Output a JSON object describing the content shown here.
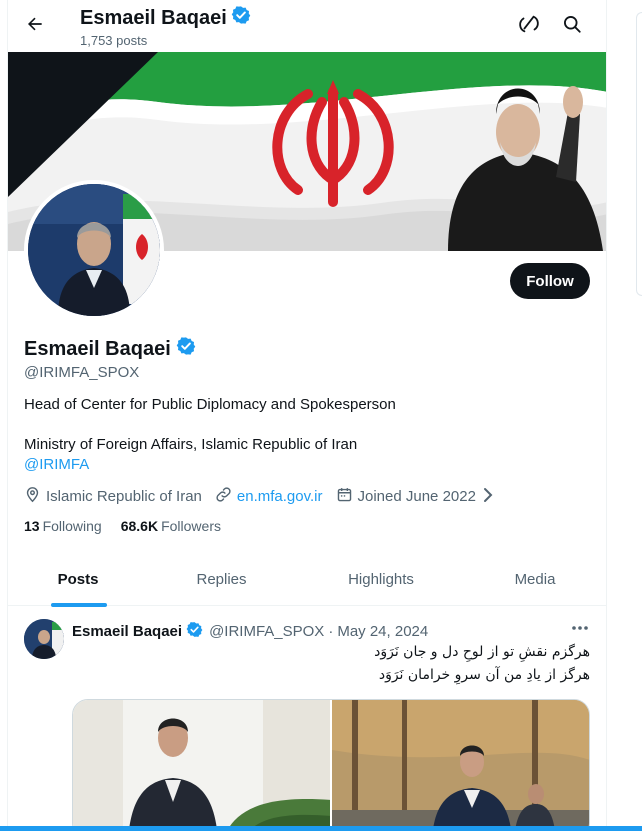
{
  "header": {
    "name": "Esmaeil Baqaei",
    "posts": "1,753 posts"
  },
  "icons": {
    "back": "arrow-left-icon",
    "grok": "grok-icon",
    "search": "search-icon",
    "verified": "verified-badge-icon"
  },
  "colors": {
    "accent": "#1d9bf0",
    "text": "#0f1419",
    "muted": "#536471"
  },
  "profile": {
    "name": "Esmaeil Baqaei",
    "handle": "@IRIMFA_SPOX",
    "bio_line1": "Head of Center for Public Diplomacy and Spokesperson",
    "bio_line2": "Ministry of Foreign Affairs, Islamic Republic of Iran",
    "bio_mention": "@IRIMFA",
    "location": "Islamic Republic of Iran",
    "website": "en.mfa.gov.ir",
    "joined": "Joined June 2022",
    "following_count": "13",
    "following_label": "Following",
    "followers_count": "68.6K",
    "followers_label": "Followers",
    "follow_button": "Follow"
  },
  "tabs": [
    {
      "label": "Posts",
      "active": true
    },
    {
      "label": "Replies"
    },
    {
      "label": "Highlights"
    },
    {
      "label": "Media"
    }
  ],
  "tweet": {
    "name": "Esmaeil Baqaei",
    "handle": "@IRIMFA_SPOX",
    "date": "May 24, 2024",
    "line1": "هرگزم نقشِ تو از لوحِ دل و جان نَرَوَد",
    "line2": "هرگز از یادِ من آن سروِ خرامان نَرَوَد"
  }
}
